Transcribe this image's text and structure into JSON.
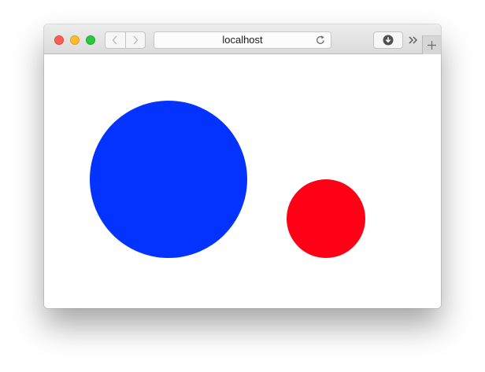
{
  "browser": {
    "address_text": "localhost",
    "icons": {
      "back": "chevron-left-icon",
      "forward": "chevron-right-icon",
      "reload": "reload-icon",
      "downloads": "download-icon",
      "overflow": "double-chevron-right-icon",
      "new_tab": "plus-icon"
    }
  },
  "page": {
    "shapes": [
      {
        "kind": "circle",
        "color": "#0433ff"
      },
      {
        "kind": "circle",
        "color": "#ff0016"
      }
    ]
  }
}
